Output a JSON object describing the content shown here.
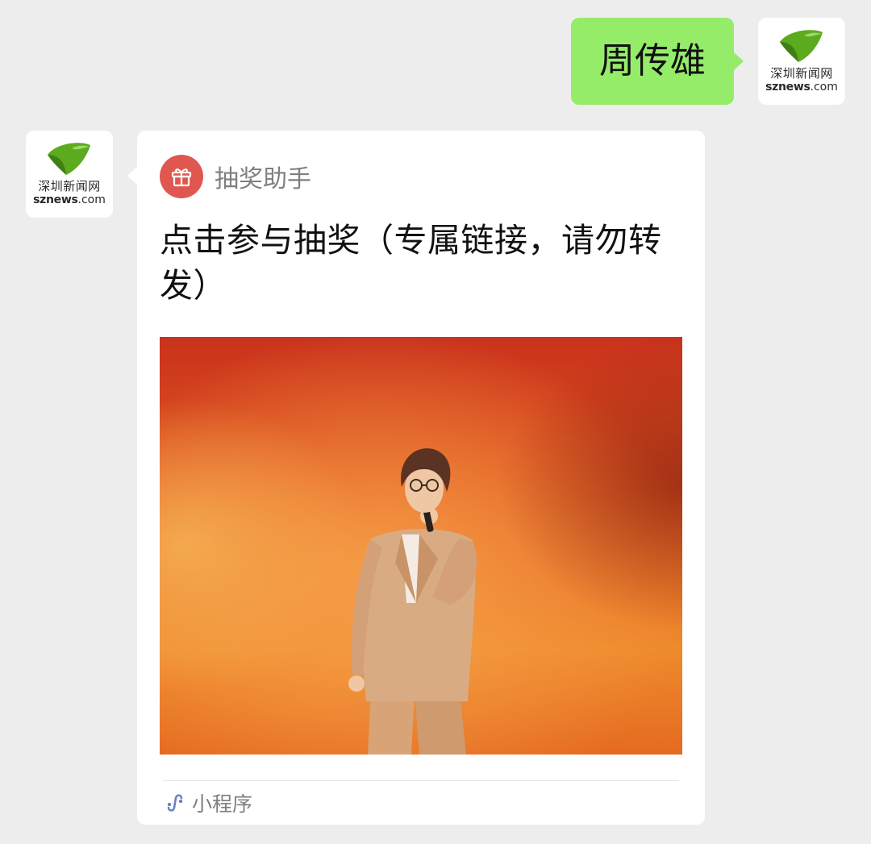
{
  "colors": {
    "chat_background": "#ededed",
    "outgoing_bubble": "#95ec69",
    "card_background": "#ffffff",
    "gift_icon": "#e0574f",
    "logo_green": "#5cab1e",
    "muted_text": "#7f7f7f"
  },
  "outgoing_message": {
    "text": "周传雄",
    "avatar": {
      "icon": "sznews-logo-icon",
      "text_cn": "深圳新闻网",
      "text_en_bold": "sznews",
      "text_en_suffix": ".com"
    }
  },
  "incoming_card": {
    "avatar": {
      "icon": "sznews-logo-icon",
      "text_cn": "深圳新闻网",
      "text_en_bold": "sznews",
      "text_en_suffix": ".com"
    },
    "source_icon": "gift-icon",
    "source_name": "抽奖助手",
    "title": "点击参与抽奖（专属链接，请勿转发）",
    "image_icon": "concert-photo",
    "footer_icon": "mini-program-icon",
    "footer_label": "小程序"
  }
}
